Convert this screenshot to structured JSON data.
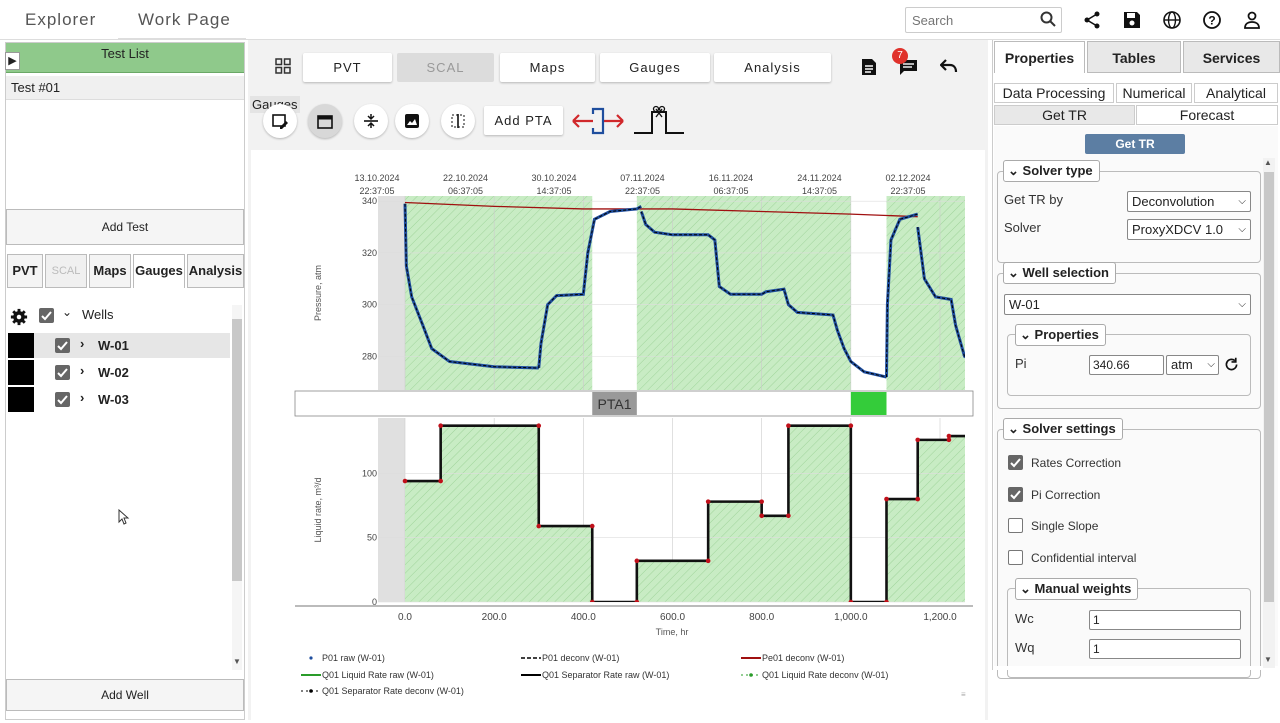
{
  "top": {
    "tabs": [
      "Explorer",
      "Work Page"
    ],
    "search_placeholder": "Search"
  },
  "left": {
    "header": "Test List",
    "test_item": "Test #01",
    "add_test": "Add Test",
    "tabs": [
      "PVT",
      "SCAL",
      "Maps",
      "Gauges",
      "Analysis"
    ],
    "tree_root": "Wells",
    "wells": [
      "W-01",
      "W-02",
      "W-03"
    ],
    "add_well": "Add Well"
  },
  "center": {
    "nav": [
      "PVT",
      "SCAL",
      "Maps",
      "Gauges",
      "Analysis"
    ],
    "notification_count": "7",
    "tooltip": "Gauges",
    "add_pta": "Add PTA",
    "pta_label": "PTA1"
  },
  "chart_data": {
    "type": "line",
    "time_ticks": [
      {
        "date": "13.10.2024",
        "time": "22:37:05"
      },
      {
        "date": "22.10.2024",
        "time": "06:37:05"
      },
      {
        "date": "30.10.2024",
        "time": "14:37:05"
      },
      {
        "date": "07.11.2024",
        "time": "22:37:05"
      },
      {
        "date": "16.11.2024",
        "time": "06:37:05"
      },
      {
        "date": "24.11.2024",
        "time": "14:37:05"
      },
      {
        "date": "02.12.2024",
        "time": "22:37:05"
      }
    ],
    "x_ticks": [
      "0.0",
      "200.0",
      "400.0",
      "600.0",
      "800.0",
      "1,000.0",
      "1,200.0"
    ],
    "xlabel": "Time, hr",
    "xlim": [
      0,
      1200
    ],
    "pressure": {
      "ylabel": "Pressure, atm",
      "yticks": [
        "280",
        "300",
        "320",
        "340"
      ],
      "ylim": [
        267,
        342
      ],
      "pe01_deconv": [
        [
          0,
          339.5
        ],
        [
          200,
          338
        ],
        [
          400,
          337
        ],
        [
          600,
          337
        ],
        [
          800,
          336
        ],
        [
          1000,
          335
        ],
        [
          1150,
          334
        ]
      ],
      "p01_raw": [
        [
          [
            0,
            339
          ],
          [
            3,
            315
          ],
          [
            15,
            303
          ],
          [
            40,
            292
          ],
          [
            60,
            283
          ],
          [
            100,
            278
          ],
          [
            200,
            276
          ],
          [
            300,
            275.5
          ]
        ],
        [
          [
            300,
            275.5
          ],
          [
            305,
            285
          ],
          [
            320,
            300
          ],
          [
            340,
            303.5
          ],
          [
            400,
            304
          ],
          [
            410,
            320
          ],
          [
            425,
            333
          ],
          [
            460,
            336
          ],
          [
            520,
            337
          ],
          [
            530,
            338
          ]
        ],
        [
          [
            530,
            336
          ],
          [
            540,
            331
          ],
          [
            560,
            328
          ],
          [
            600,
            327
          ],
          [
            680,
            327
          ],
          [
            695,
            325
          ],
          [
            705,
            307
          ],
          [
            730,
            304
          ],
          [
            800,
            304
          ],
          [
            810,
            305
          ],
          [
            850,
            306
          ],
          [
            860,
            300
          ],
          [
            880,
            297
          ],
          [
            960,
            296
          ],
          [
            970,
            290
          ],
          [
            985,
            283
          ],
          [
            1000,
            278
          ],
          [
            1030,
            274
          ],
          [
            1080,
            272
          ]
        ],
        [
          [
            1080,
            272
          ],
          [
            1082,
            300
          ],
          [
            1090,
            325
          ],
          [
            1110,
            333
          ],
          [
            1150,
            335
          ]
        ],
        [
          [
            1150,
            330
          ],
          [
            1165,
            310
          ],
          [
            1190,
            303
          ],
          [
            1225,
            302
          ],
          [
            1235,
            292
          ],
          [
            1255,
            280
          ],
          [
            1290,
            277
          ]
        ]
      ]
    },
    "rate": {
      "ylabel": "Liquid rate, m³/d",
      "yticks": [
        "0",
        "50",
        "100"
      ],
      "ylim": [
        0,
        143
      ],
      "q01_separator_raw": [
        [
          0,
          94
        ],
        [
          80,
          94
        ],
        [
          80,
          137
        ],
        [
          300,
          137
        ],
        [
          300,
          59
        ],
        [
          420,
          59
        ],
        [
          420,
          0
        ],
        [
          520,
          0
        ],
        [
          520,
          32
        ],
        [
          680,
          32
        ],
        [
          680,
          78
        ],
        [
          800,
          78
        ],
        [
          800,
          67
        ],
        [
          860,
          67
        ],
        [
          860,
          137
        ],
        [
          1000,
          137
        ],
        [
          1000,
          0
        ],
        [
          1080,
          0
        ],
        [
          1080,
          80
        ],
        [
          1150,
          80
        ],
        [
          1150,
          126
        ],
        [
          1220,
          126
        ],
        [
          1220,
          129
        ],
        [
          1300,
          129
        ]
      ],
      "points": [
        [
          0,
          94
        ],
        [
          80,
          94
        ],
        [
          80,
          137
        ],
        [
          300,
          137
        ],
        [
          300,
          59
        ],
        [
          420,
          59
        ],
        [
          420,
          0
        ],
        [
          520,
          0
        ],
        [
          520,
          32
        ],
        [
          680,
          32
        ],
        [
          680,
          78
        ],
        [
          800,
          78
        ],
        [
          800,
          67
        ],
        [
          860,
          67
        ],
        [
          860,
          137
        ],
        [
          1000,
          137
        ],
        [
          1000,
          0
        ],
        [
          1080,
          0
        ],
        [
          1080,
          80
        ],
        [
          1150,
          80
        ],
        [
          1150,
          126
        ],
        [
          1220,
          126
        ],
        [
          1220,
          129
        ]
      ]
    },
    "bands": [
      [
        0,
        420
      ],
      [
        520,
        1000
      ],
      [
        1080,
        1300
      ]
    ],
    "legend": [
      "P01 raw (W-01)",
      "P01 deconv (W-01)",
      "Pe01 deconv (W-01)",
      "Q01 Liquid Rate raw (W-01)",
      "Q01 Separator Rate raw (W-01)",
      "Q01 Liquid Rate deconv (W-01)",
      "Q01 Separator Rate deconv (W-01)"
    ],
    "colors": {
      "band": "#c8ecc4",
      "pressure": "#1f4e9e",
      "pe": "#a01010",
      "rate": "#111111",
      "points": "#c0101a",
      "pta": "#34cc3a"
    }
  },
  "right": {
    "tabs": [
      "Properties",
      "Tables",
      "Services"
    ],
    "subtabs": [
      "Data Processing",
      "Numerical",
      "Analytical"
    ],
    "subtabs2": [
      "Get TR",
      "Forecast"
    ],
    "get_tr_button": "Get TR",
    "solver_type": "Solver type",
    "get_tr_by_label": "Get TR by",
    "get_tr_by_value": "Deconvolution",
    "solver_label": "Solver",
    "solver_value": "ProxyXDCV 1.0",
    "well_selection": "Well selection",
    "well_value": "W-01",
    "properties": "Properties",
    "pi_label": "Pi",
    "pi_value": "340.66",
    "pi_unit": "atm",
    "solver_settings": "Solver settings",
    "options": [
      {
        "label": "Rates Correction",
        "checked": true
      },
      {
        "label": "Pi Correction",
        "checked": true
      },
      {
        "label": "Single Slope",
        "checked": false
      },
      {
        "label": "Confidential interval",
        "checked": false
      }
    ],
    "manual_weights": "Manual weights",
    "wc_label": "Wc",
    "wc_value": "1",
    "wq_label": "Wq",
    "wq_value": "1"
  }
}
